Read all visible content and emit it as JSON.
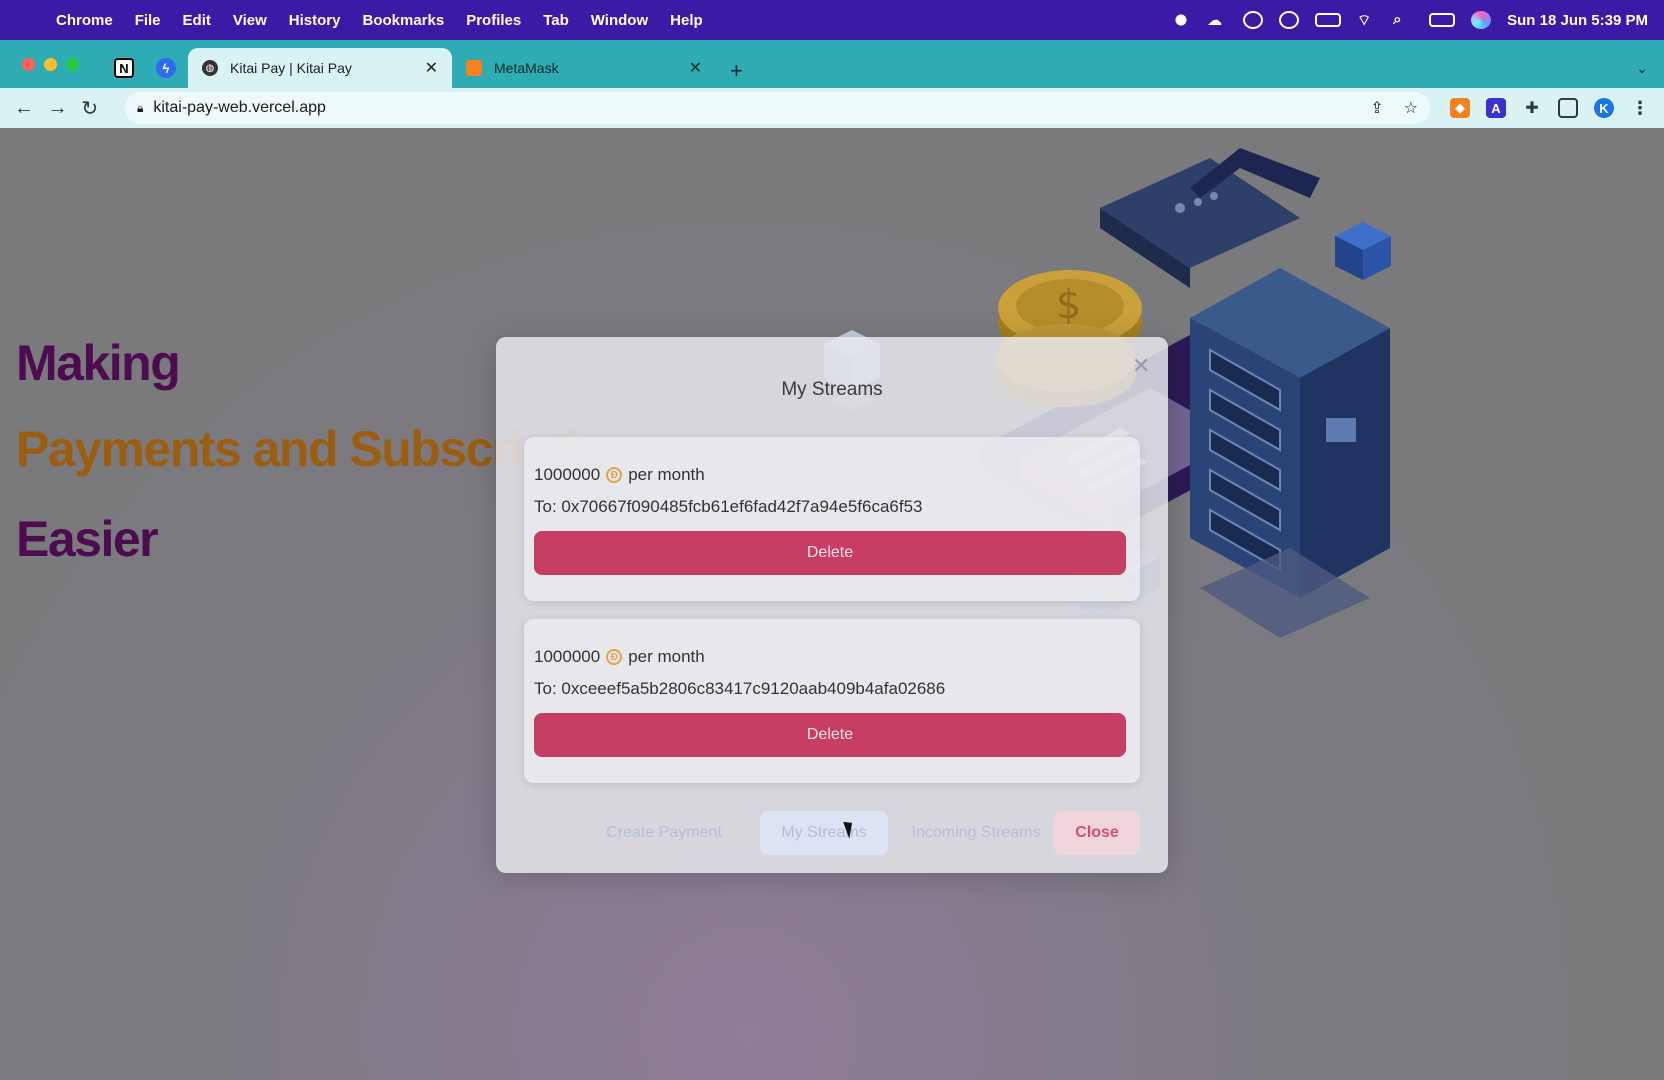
{
  "menubar": {
    "app": "Chrome",
    "items": [
      "File",
      "Edit",
      "View",
      "History",
      "Bookmarks",
      "Profiles",
      "Tab",
      "Window",
      "Help"
    ],
    "clock": "Sun 18 Jun  5:39 PM"
  },
  "tabs": [
    {
      "title": "Kitai Pay | Kitai Pay",
      "icon": "globe-icon",
      "active": true
    },
    {
      "title": "MetaMask",
      "icon": "metamask-fox-icon",
      "active": false
    }
  ],
  "address_bar": {
    "url": "kitai-pay-web.vercel.app"
  },
  "hero": {
    "line1": "Making",
    "line2": "Payments and Subscriptions",
    "line3": "Easier"
  },
  "modal": {
    "title": "My Streams",
    "streams": [
      {
        "amount": "1000000",
        "period": "per month",
        "to": "To: 0x70667f090485fcb61ef6fad42f7a94e5f6ca6f53",
        "delete_label": "Delete"
      },
      {
        "amount": "1000000",
        "period": "per month",
        "to": "To: 0xceeef5a5b2806c83417c9120aab409b4afa02686",
        "delete_label": "Delete"
      }
    ],
    "footer": {
      "create_payment": "Create Payment",
      "my_streams": "My Streams",
      "incoming_streams": "Incoming Streams",
      "close": "Close"
    }
  },
  "colors": {
    "menubar": "#3b1aa6",
    "tabstrip": "#2eabb3",
    "delete": "#c73e64",
    "hero_purple": "#4d0c4f",
    "hero_gold": "#9b5d10"
  }
}
